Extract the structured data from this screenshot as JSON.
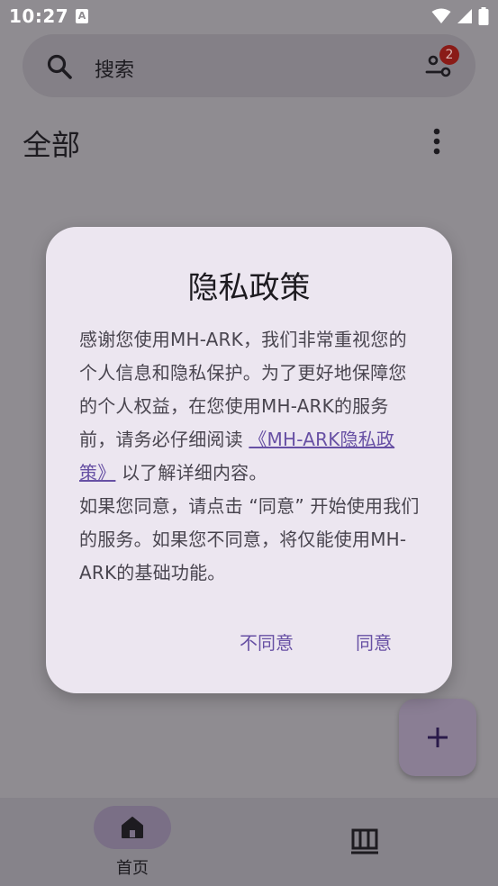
{
  "status_bar": {
    "time": "10:27",
    "notification_icon": "A"
  },
  "search": {
    "placeholder": "搜索",
    "filter_badge_count": "2"
  },
  "section": {
    "title": "全部"
  },
  "dialog": {
    "title": "隐私政策",
    "body_part1": "感谢您使用MH-ARK，我们非常重视您的个人信息和隐私保护。为了更好地保障您的个人权益，在您使用MH-ARK的服务前，请务必仔细阅读 ",
    "policy_link": "《MH-ARK隐私政策》",
    "body_part2": " 以了解详细内容。",
    "body_para2": "如果您同意，请点击 “同意” 开始使用我们的服务。如果您不同意，将仅能使用MH-ARK的基础功能。",
    "disagree_label": "不同意",
    "agree_label": "同意"
  },
  "bottom_nav": {
    "home_label": "首页"
  },
  "colors": {
    "accent": "#6750a4",
    "badge": "#8a1b17",
    "dialog_bg": "#ece6f0",
    "scrim_bg": "#8f8c91"
  }
}
